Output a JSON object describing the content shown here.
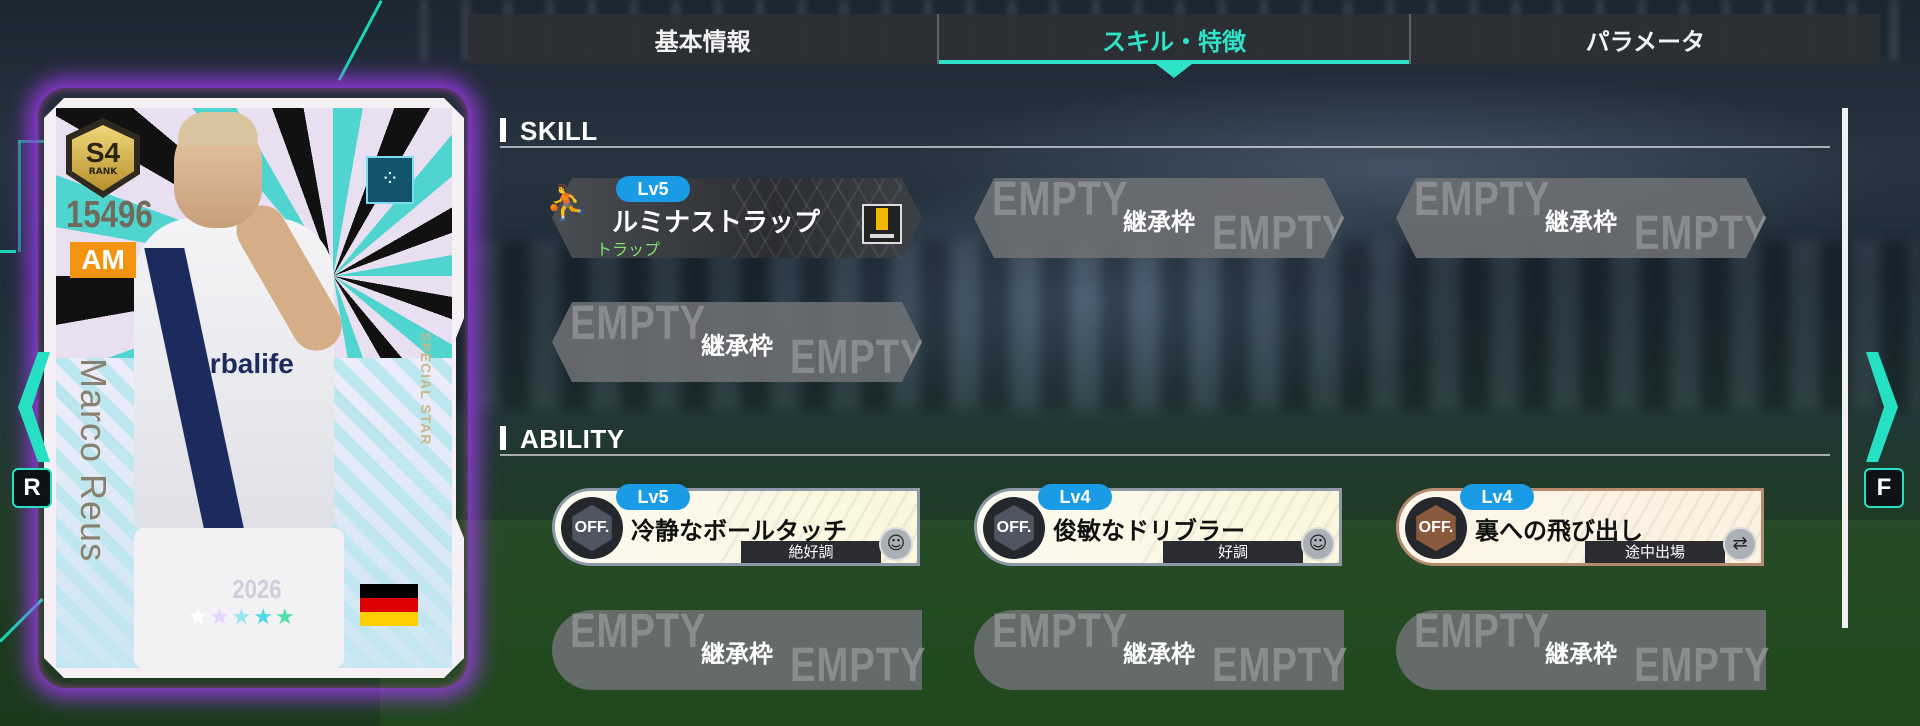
{
  "tabs": [
    {
      "label": "基本情報",
      "active": false
    },
    {
      "label": "スキル・特徴",
      "active": true
    },
    {
      "label": "パラメータ",
      "active": false
    }
  ],
  "sections": {
    "skill": "SKILL",
    "ability": "ABILITY"
  },
  "skill_slots": [
    {
      "type": "skill",
      "level": "Lv5",
      "name": "ルミナストラップ",
      "category": "トラップ",
      "icon": "player-trap-icon",
      "type_icon": "trap-type-icon"
    },
    {
      "type": "empty",
      "label": "継承枠",
      "watermark": "EMPTY"
    },
    {
      "type": "empty",
      "label": "継承枠",
      "watermark": "EMPTY"
    },
    {
      "type": "empty",
      "label": "継承枠",
      "watermark": "EMPTY"
    }
  ],
  "ability_slots": [
    {
      "type": "ability",
      "level": "Lv5",
      "name": "冷静なボールタッチ",
      "condition": "絶好調",
      "badge": "OFF.",
      "tier": "silver",
      "condition_icon": "smile-icon"
    },
    {
      "type": "ability",
      "level": "Lv4",
      "name": "俊敏なドリブラー",
      "condition": "好調",
      "badge": "OFF.",
      "tier": "silver",
      "condition_icon": "smile-icon"
    },
    {
      "type": "ability",
      "level": "Lv4",
      "name": "裏への飛び出し",
      "condition": "途中出場",
      "badge": "OFF.",
      "tier": "bronze",
      "condition_icon": "substitute-icon"
    },
    {
      "type": "empty",
      "label": "継承枠",
      "watermark": "EMPTY"
    },
    {
      "type": "empty",
      "label": "継承枠",
      "watermark": "EMPTY"
    },
    {
      "type": "empty",
      "label": "継承枠",
      "watermark": "EMPTY"
    }
  ],
  "card": {
    "rank": "S4",
    "rank_label": "RANK",
    "rating": "15496",
    "position": "AM",
    "name": "Marco Reus",
    "edition": "SPECIAL STAR",
    "year": "2026",
    "sponsor": "Herbalife",
    "stars_filled": 5,
    "nationality": "Germany",
    "flag_colors": [
      "#000000",
      "#dd0000",
      "#ffce00"
    ]
  },
  "nav": {
    "left_key": "R",
    "right_key": "F"
  },
  "colors": {
    "accent": "#2fe3c8",
    "level_badge": "#1a9be6",
    "position": "#f29411"
  }
}
